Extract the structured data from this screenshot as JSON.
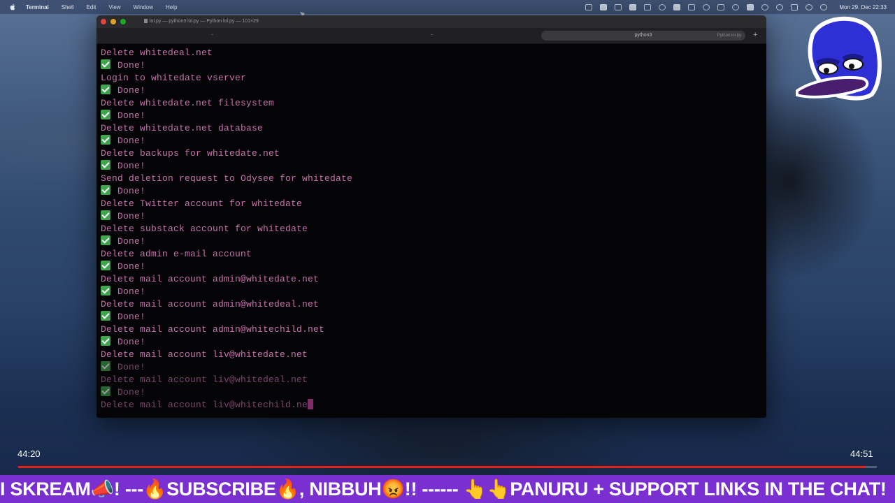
{
  "menubar": {
    "items": [
      "Terminal",
      "Shell",
      "Edit",
      "View",
      "Window",
      "Help"
    ],
    "clock": "Mon 29. Dec 22:33"
  },
  "terminal": {
    "window_title": "lol.py — python3 lol.py — Python lol.py — 101×29",
    "tab_label": "python3",
    "tab_close_hint": "Python lol.py",
    "lines": [
      {
        "type": "text",
        "text": "Delete whitedeal.net"
      },
      {
        "type": "done",
        "text": "Done!"
      },
      {
        "type": "text",
        "text": "Login to whitedate vserver"
      },
      {
        "type": "done",
        "text": "Done!"
      },
      {
        "type": "text",
        "text": "Delete whitedate.net filesystem"
      },
      {
        "type": "done",
        "text": "Done!"
      },
      {
        "type": "text",
        "text": "Delete whitedate.net database"
      },
      {
        "type": "done",
        "text": "Done!"
      },
      {
        "type": "text",
        "text": "Delete backups for whitedate.net"
      },
      {
        "type": "done",
        "text": "Done!"
      },
      {
        "type": "text",
        "text": "Send deletion request to Odysee for whitedate"
      },
      {
        "type": "done",
        "text": "Done!"
      },
      {
        "type": "text",
        "text": "Delete Twitter account for whitedate"
      },
      {
        "type": "done",
        "text": "Done!"
      },
      {
        "type": "text",
        "text": "Delete substack account for whitedate"
      },
      {
        "type": "done",
        "text": "Done!"
      },
      {
        "type": "text",
        "text": "Delete admin e-mail account"
      },
      {
        "type": "done",
        "text": "Done!"
      },
      {
        "type": "text",
        "text": "Delete mail account admin@whitedate.net"
      },
      {
        "type": "done",
        "text": "Done!"
      },
      {
        "type": "text",
        "text": "Delete mail account admin@whitedeal.net"
      },
      {
        "type": "done",
        "text": "Done!"
      },
      {
        "type": "text",
        "text": "Delete mail account admin@whitechild.net"
      },
      {
        "type": "done",
        "text": "Done!"
      },
      {
        "type": "text",
        "text": "Delete mail account liv@whitedate.net"
      },
      {
        "type": "done",
        "text": "Done!"
      },
      {
        "type": "text",
        "text": "Delete mail account liv@whitedeal.net"
      },
      {
        "type": "done",
        "text": "Done!"
      },
      {
        "type": "cursor",
        "text": "Delete mail account liv@whitechild.ne"
      }
    ]
  },
  "player": {
    "current_time": "44:20",
    "total_time": "44:51",
    "progress_fraction": 0.987
  },
  "ticker": {
    "text": "I SKREAM📣! ---🔥SUBSCRIBE🔥, NIBBUH😡!! ------ 👆👆PANURU + SUPPORT LINKS IN THE CHAT!"
  },
  "colors": {
    "terminal_text": "#c96fae",
    "checkmark": "#3fa64f",
    "ticker_bg": "#7a2fd0",
    "progress": "#e62117"
  },
  "icons": [
    "apple-icon",
    "wifi-icon",
    "battery-icon",
    "search-icon",
    "control-center-icon",
    "mascot-avatar-icon"
  ]
}
